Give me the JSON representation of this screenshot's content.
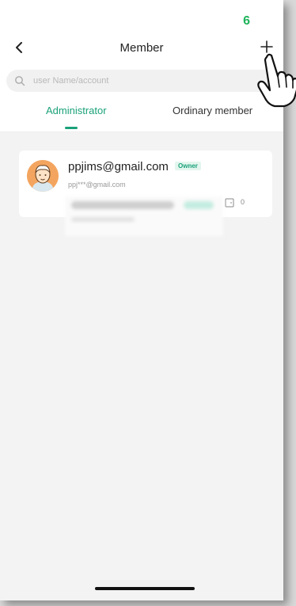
{
  "status": {
    "badge": "6",
    "badge_color": "#1fb35a"
  },
  "header": {
    "title": "Member",
    "back_icon": "chevron-left-icon",
    "add_icon": "plus-icon"
  },
  "search": {
    "placeholder": "user Name/account",
    "value": ""
  },
  "tabs": [
    {
      "label": "Administrator",
      "active": true
    },
    {
      "label": "Ordinary member",
      "active": false
    }
  ],
  "accent_color": "#1aa179",
  "members": [
    {
      "name": "ppjims@gmail.com",
      "role_badge": "Owner",
      "account": "ppj***@gmail.com",
      "device_count": "0"
    }
  ]
}
